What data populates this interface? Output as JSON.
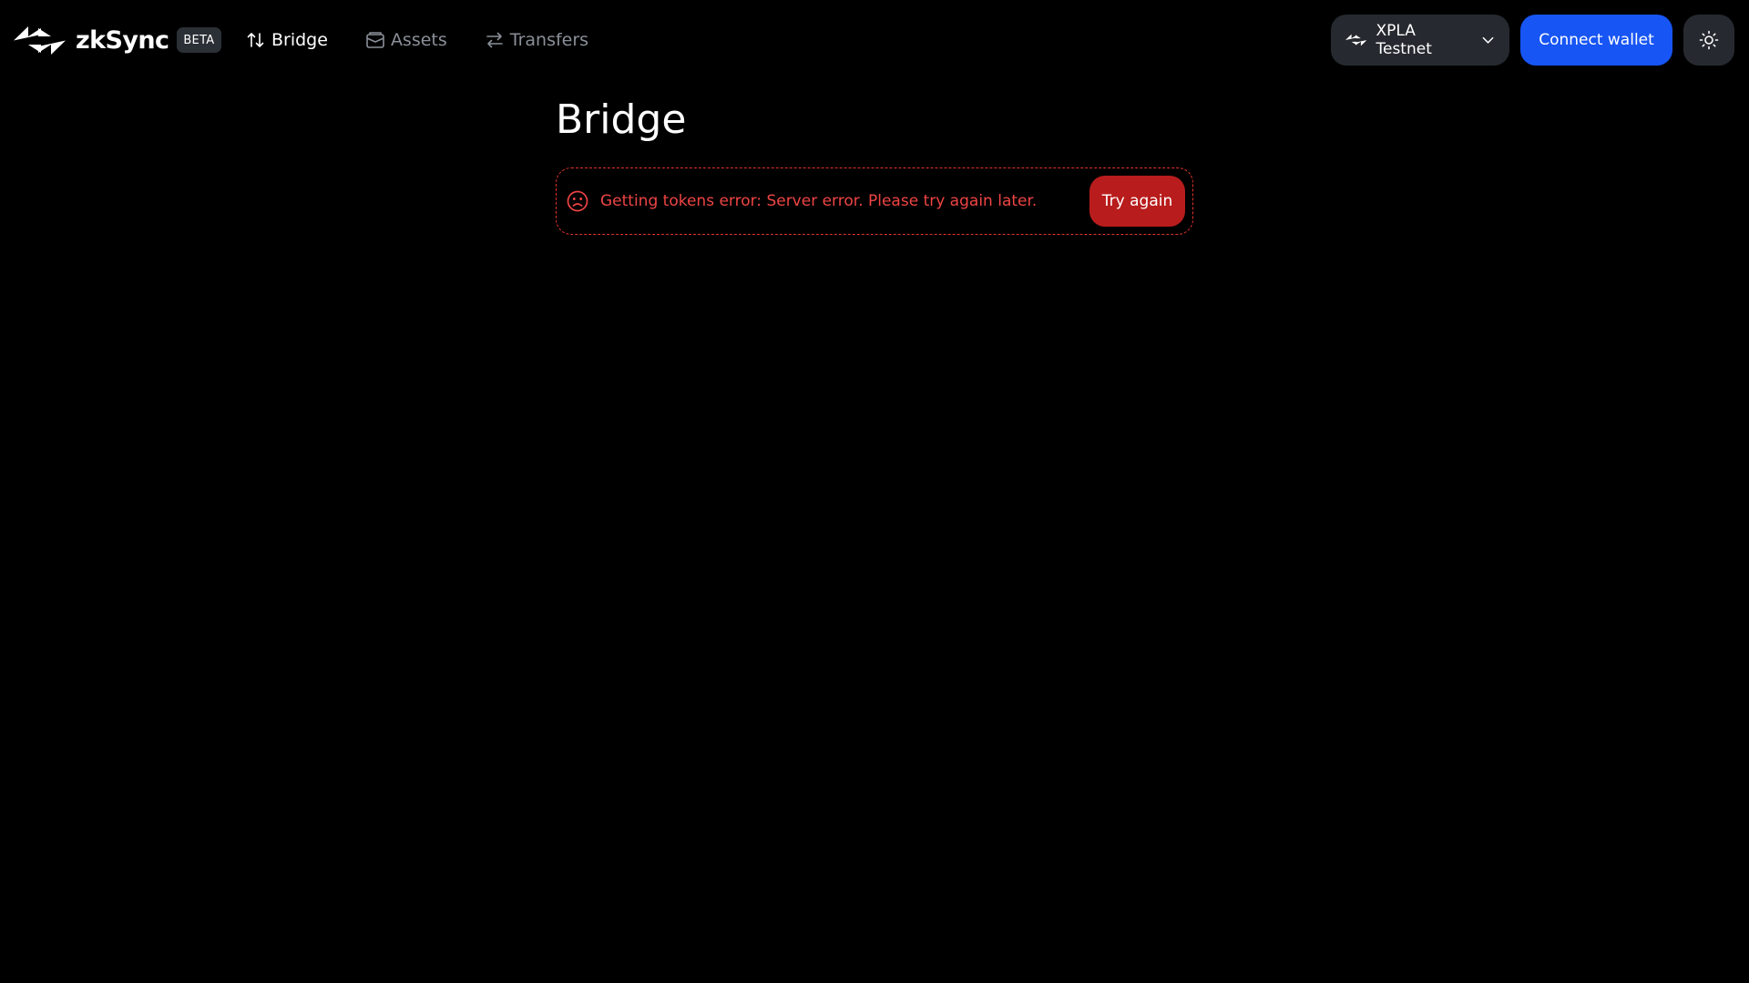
{
  "brand": {
    "name": "zkSync",
    "badge": "BETA",
    "logo_icon": "zksync-logo-icon"
  },
  "nav": {
    "items": [
      {
        "label": "Bridge",
        "icon": "swap-vertical-icon",
        "active": true
      },
      {
        "label": "Assets",
        "icon": "wallet-icon",
        "active": false
      },
      {
        "label": "Transfers",
        "icon": "swap-horizontal-icon",
        "active": false
      }
    ]
  },
  "header": {
    "network": {
      "label": "XPLA Testnet",
      "icon": "zksync-network-icon",
      "dropdown_icon": "chevron-down-icon"
    },
    "connect_label": "Connect wallet",
    "theme_icon": "sun-icon"
  },
  "main": {
    "title": "Bridge",
    "error": {
      "icon": "sad-face-icon",
      "message": "Getting tokens error: Server error. Please try again later.",
      "retry_label": "Try again"
    }
  },
  "colors": {
    "background": "#000000",
    "nav_inactive": "#8a8f98",
    "surface": "#262a30",
    "primary_button": "#1755f4",
    "error_text": "#ef4444",
    "error_button": "#b91c1c"
  }
}
